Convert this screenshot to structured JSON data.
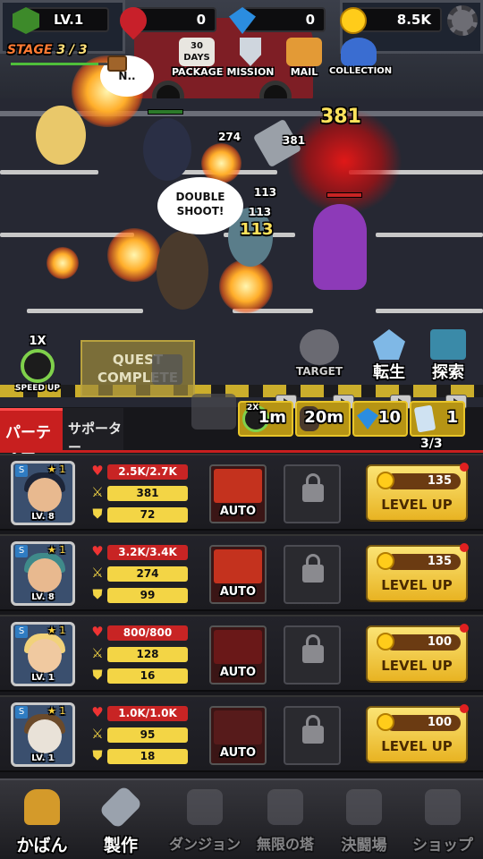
{
  "topbar": {
    "level": "LV.1",
    "rubies": "0",
    "gems": "0",
    "gold": "8.5K"
  },
  "stage": {
    "label": "STAGE",
    "value": "3 / 3"
  },
  "menu": {
    "package_days": "30 DAYS",
    "package": "PACKAGE",
    "mission": "MISSION",
    "mail": "MAIL",
    "collection": "COLLECTION"
  },
  "battle": {
    "boss_bubble": "N..",
    "shout": "DOUBLE SHOOT!",
    "damage_big": "381",
    "damage_a": "274",
    "damage_b": "381",
    "damage_c": "113",
    "damage_d": "113",
    "damage_e": "113"
  },
  "controls": {
    "speed": "1X",
    "speed_label": "SPEED UP",
    "quest": "QUEST COMPLETE",
    "target": "TARGET",
    "rebirth": "転生",
    "explore": "探索"
  },
  "boosts": {
    "speed_tag": "2X",
    "speed_label": "SPEED UP",
    "speed_time": "1m",
    "hero_time": "20m",
    "gems": "10",
    "tickets": "1",
    "party_count": "3/3"
  },
  "tabs": {
    "party": "パーティー",
    "supporter": "サポーター"
  },
  "heroes": [
    {
      "rank": "S",
      "stars": "1",
      "level": "LV. 8",
      "hp": "2.5K/2.7K",
      "atk": "381",
      "def": "72",
      "skill": "AUTO",
      "cost": "135",
      "action": "LEVEL UP"
    },
    {
      "rank": "S",
      "stars": "1",
      "level": "LV. 8",
      "hp": "3.2K/3.4K",
      "atk": "274",
      "def": "99",
      "skill": "AUTO",
      "cost": "135",
      "action": "LEVEL UP"
    },
    {
      "rank": "S",
      "stars": "1",
      "level": "LV. 1",
      "hp": "800/800",
      "atk": "128",
      "def": "16",
      "skill": "AUTO",
      "cost": "100",
      "action": "LEVEL UP"
    },
    {
      "rank": "S",
      "stars": "1",
      "level": "LV. 1",
      "hp": "1.0K/1.0K",
      "atk": "95",
      "def": "18",
      "skill": "AUTO",
      "cost": "100",
      "action": "LEVEL UP"
    }
  ],
  "nav": {
    "bag": "かばん",
    "craft": "製作",
    "dungeon": "ダンジョン",
    "tower": "無限の塔",
    "arena": "決闘場",
    "shop": "ショップ"
  },
  "colors": {
    "accent": "#f3d545",
    "hp": "#c82424",
    "stage": "#ff7a33",
    "rank": "#2f7cc2"
  }
}
